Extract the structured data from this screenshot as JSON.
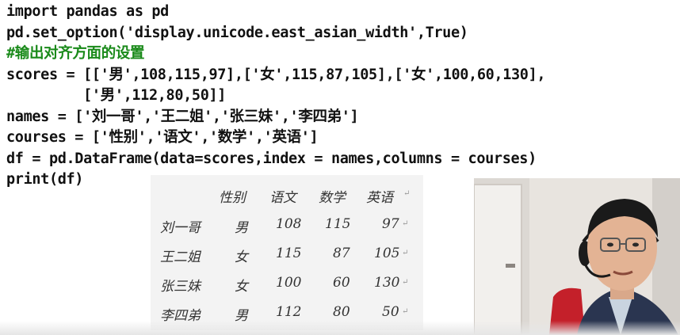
{
  "code": {
    "lines": [
      "import pandas as pd",
      "pd.set_option('display.unicode.east_asian_width',True)",
      "#输出对齐方面的设置",
      "scores = [['男',108,115,97],['女',115,87,105],['女',100,60,130],",
      "         ['男',112,80,50]]",
      "names = ['刘一哥','王二姐','张三妹','李四弟']",
      "courses = ['性别','语文','数学','英语']",
      "df = pd.DataFrame(data=scores,index = names,columns = courses)",
      "print(df)"
    ]
  },
  "output_table": {
    "columns": [
      "性别",
      "语文",
      "数学",
      "英语"
    ],
    "rows": [
      {
        "index": "刘一哥",
        "values": [
          "男",
          "108",
          "115",
          "97"
        ]
      },
      {
        "index": "王二姐",
        "values": [
          "女",
          "115",
          "87",
          "105"
        ]
      },
      {
        "index": "张三妹",
        "values": [
          "女",
          "100",
          "60",
          "130"
        ]
      },
      {
        "index": "李四弟",
        "values": [
          "男",
          "112",
          "80",
          "50"
        ]
      }
    ],
    "line_end_mark": "↵"
  },
  "colors": {
    "code_text": "#111111",
    "comment": "#1a8a1a",
    "output_bg": "#f3f3f3"
  }
}
